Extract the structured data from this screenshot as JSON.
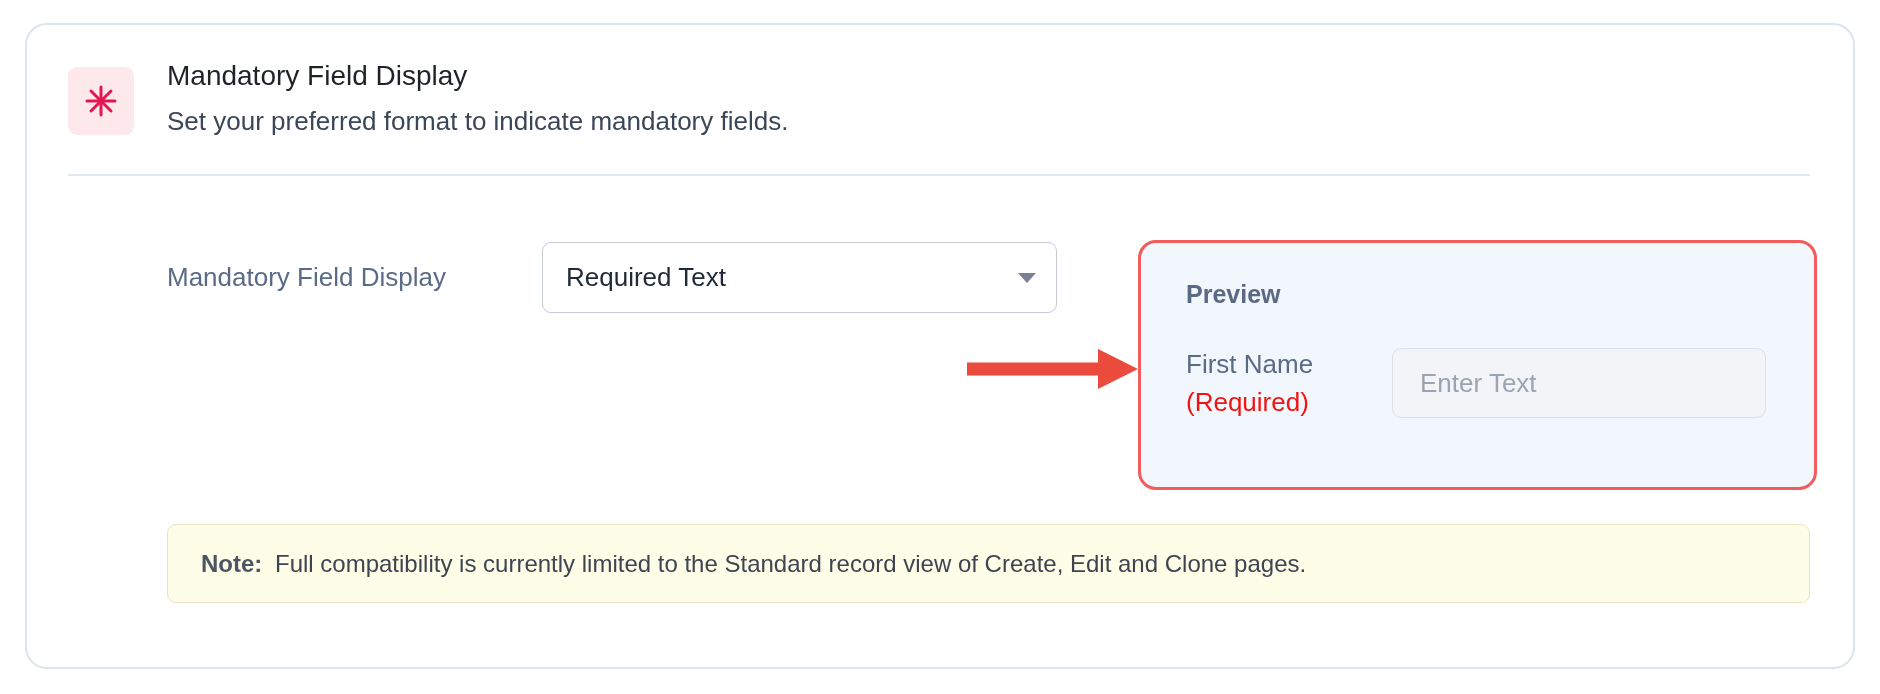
{
  "section": {
    "title": "Mandatory Field Display",
    "description": "Set your preferred format to indicate mandatory fields."
  },
  "setting": {
    "label": "Mandatory Field Display",
    "value": "Required Text"
  },
  "preview": {
    "title": "Preview",
    "field_label": "First Name",
    "required_marker": "(Required)",
    "placeholder": "Enter Text"
  },
  "note": {
    "text": "**Note:** Full compatibility is currently limited to the Standard record view of Create, Edit and Clone pages."
  }
}
